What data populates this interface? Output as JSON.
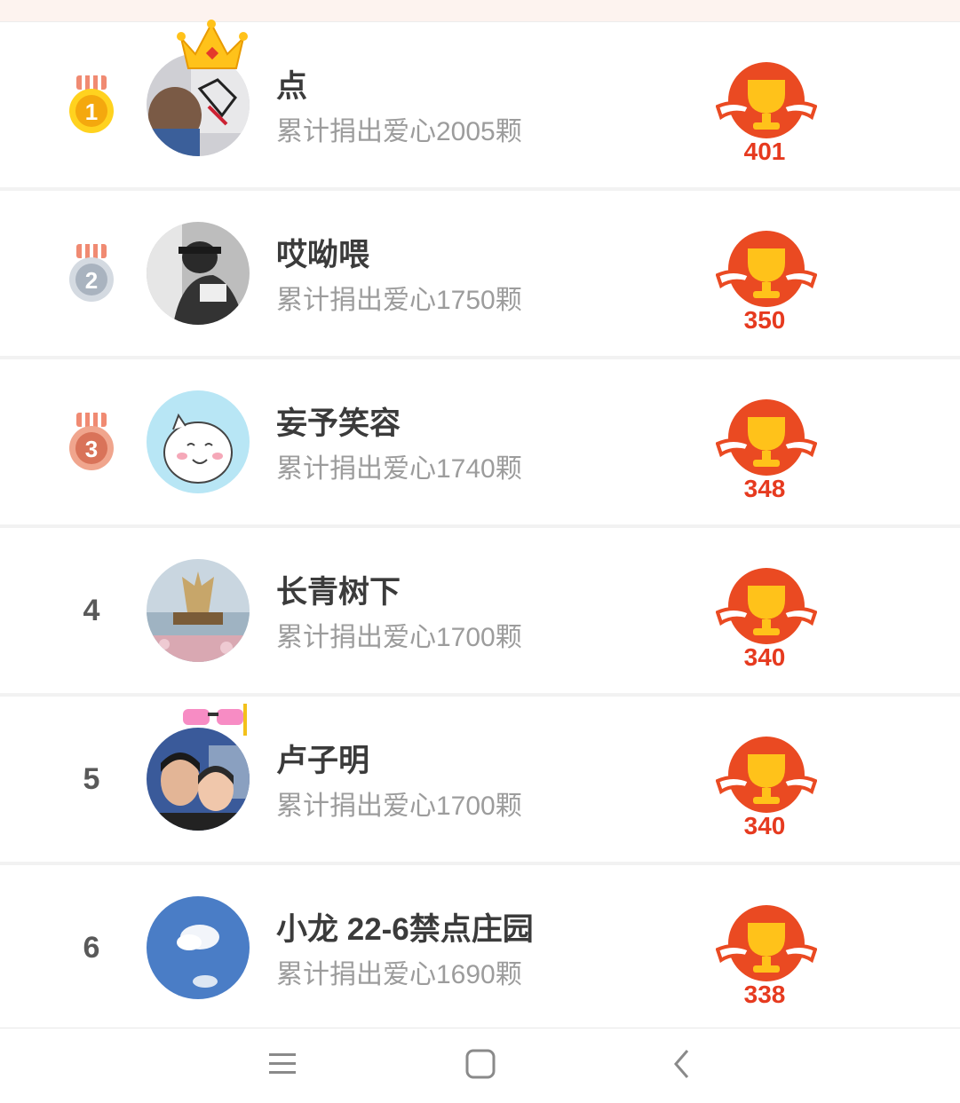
{
  "leaderboard": {
    "rows": [
      {
        "rank": "1",
        "rank_type": "gold-medal",
        "name": "点",
        "subtitle": "累计捐出爱心2005颗",
        "score": "401",
        "avatar": "avatar-photo-crown"
      },
      {
        "rank": "2",
        "rank_type": "silver-medal",
        "name": "哎呦喂",
        "subtitle": "累计捐出爱心1750颗",
        "score": "350",
        "avatar": "avatar-photo"
      },
      {
        "rank": "3",
        "rank_type": "bronze-medal",
        "name": "妄予笑容",
        "subtitle": "累计捐出爱心1740颗",
        "score": "348",
        "avatar": "avatar-cartoon"
      },
      {
        "rank": "4",
        "rank_type": "number",
        "name": "长青树下",
        "subtitle": "累计捐出爱心1700颗",
        "score": "340",
        "avatar": "avatar-landscape"
      },
      {
        "rank": "5",
        "rank_type": "number",
        "name": "卢子明",
        "subtitle": "累计捐出爱心1700颗",
        "score": "340",
        "avatar": "avatar-couple-glasses"
      },
      {
        "rank": "6",
        "rank_type": "number",
        "name": "小龙 22-6禁点庄园",
        "subtitle": "累计捐出爱心1690颗",
        "score": "338",
        "avatar": "avatar-sky"
      }
    ]
  },
  "navbar": {
    "menu_icon": "menu-icon",
    "home_icon": "home-icon",
    "back_icon": "back-icon"
  },
  "colors": {
    "accent": "#e63a1f",
    "gold": "#f5c518",
    "silver": "#c5cbd3",
    "bronze": "#e08a6d"
  }
}
